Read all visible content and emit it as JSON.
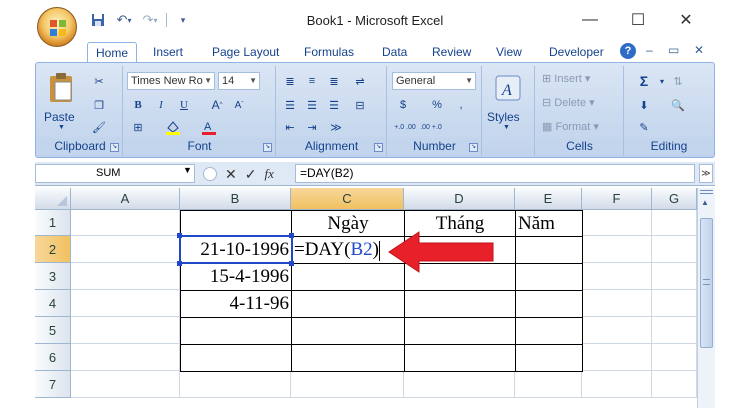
{
  "window": {
    "title": "Book1 - Microsoft Excel",
    "minimize": "—",
    "maximize": "☐",
    "close": "✕"
  },
  "qat": {
    "save": "💾",
    "undo": "↶",
    "undo_drop": "▾",
    "redo": "↷",
    "redo_drop": "▾",
    "customize": "▾"
  },
  "tabs": [
    {
      "label": "Home",
      "active": true
    },
    {
      "label": "Insert"
    },
    {
      "label": "Page Layout"
    },
    {
      "label": "Formulas"
    },
    {
      "label": "Data"
    },
    {
      "label": "Review"
    },
    {
      "label": "View"
    },
    {
      "label": "Developer"
    }
  ],
  "ribbon_right": {
    "help": "?",
    "min": "–",
    "restore": "▭",
    "close": "✕"
  },
  "ribbon": {
    "clipboard": {
      "label": "Clipboard",
      "paste": "Paste"
    },
    "font": {
      "label": "Font",
      "name": "Times New Ro",
      "size": "14"
    },
    "alignment": {
      "label": "Alignment"
    },
    "number": {
      "label": "Number",
      "format": "General",
      "currency": "$",
      "percent": "%",
      "comma": ",",
      "inc": "+.0 .00",
      "dec": ".00 +.0"
    },
    "styles": {
      "label": "Styles"
    },
    "cells": {
      "label": "Cells",
      "insert": "Insert",
      "delete": "Delete",
      "format": "Format"
    },
    "editing": {
      "label": "Editing",
      "sum": "Σ"
    }
  },
  "formula_bar": {
    "name_box": "SUM",
    "cancel": "✕",
    "enter": "✓",
    "fx": "fx",
    "content": "=DAY(B2)"
  },
  "columns": [
    "A",
    "B",
    "C",
    "D",
    "E",
    "F",
    "G"
  ],
  "rows": [
    "1",
    "2",
    "3",
    "4",
    "5",
    "6",
    "7"
  ],
  "cells": {
    "C1": "Ngày",
    "D1": "Tháng",
    "E1": "Năm",
    "B2": "21-10-1996",
    "C2_prefix": "=DAY(",
    "C2_ref": "B2",
    "C2_suffix": ")",
    "B3": "15-4-1996",
    "B4": "4-11-96"
  },
  "colors": {
    "reference_blue": "#1f49c9",
    "arrow_red": "#e8202a",
    "selected_header": "#f1c15f"
  }
}
